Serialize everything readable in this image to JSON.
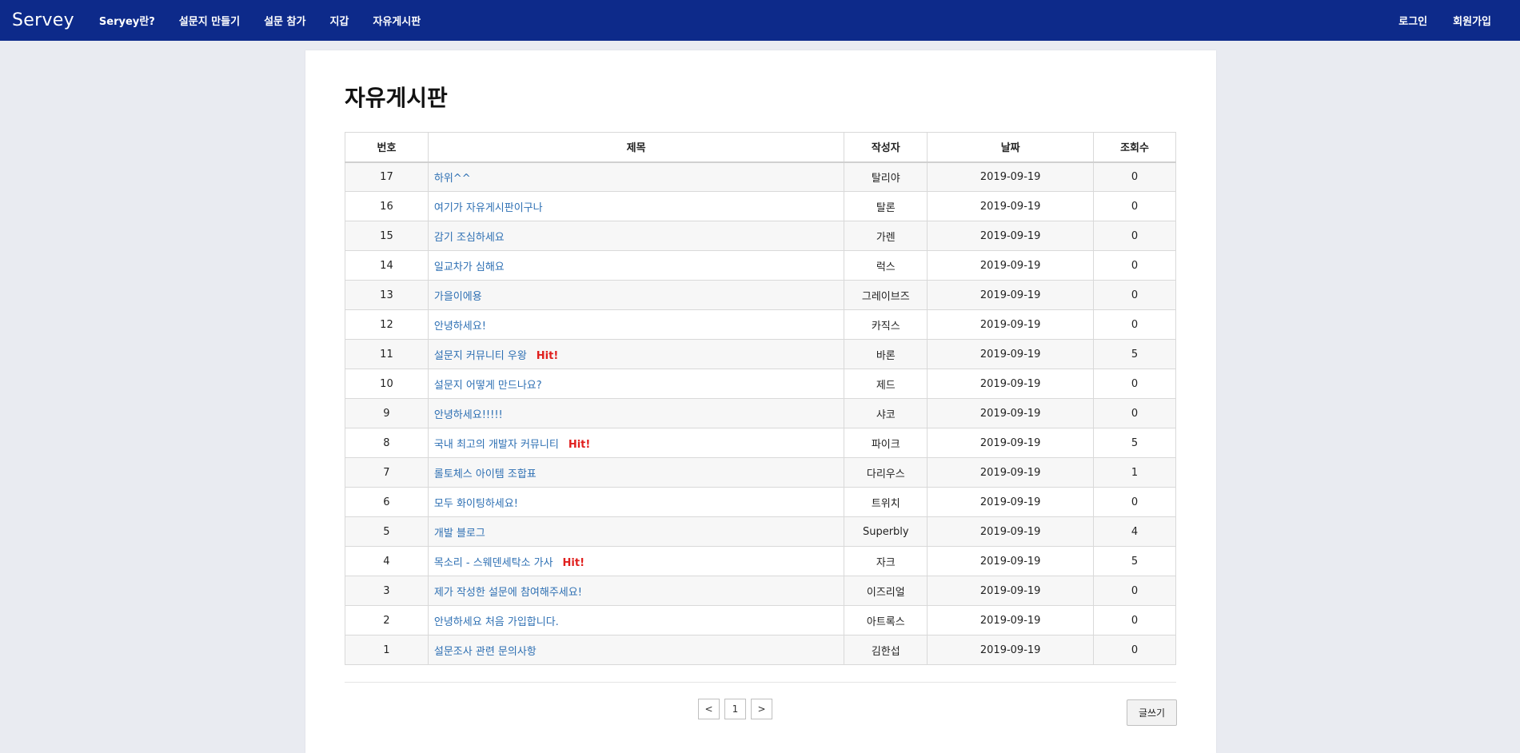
{
  "nav": {
    "brand": "Servey",
    "links": [
      "Seryey란?",
      "설문지 만들기",
      "설문 참가",
      "지갑",
      "자유게시판"
    ],
    "login": "로그인",
    "signup": "회원가입"
  },
  "page": {
    "title": "자유게시판"
  },
  "table": {
    "headers": [
      "번호",
      "제목",
      "작성자",
      "날짜",
      "조회수"
    ],
    "rows": [
      {
        "no": "17",
        "title": "하위^^",
        "hit": "",
        "author": "탈리야",
        "date": "2019-09-19",
        "views": "0"
      },
      {
        "no": "16",
        "title": "여기가 자유게시판이구나",
        "hit": "",
        "author": "탈론",
        "date": "2019-09-19",
        "views": "0"
      },
      {
        "no": "15",
        "title": "감기 조심하세요",
        "hit": "",
        "author": "가렌",
        "date": "2019-09-19",
        "views": "0"
      },
      {
        "no": "14",
        "title": "일교차가 심해요",
        "hit": "",
        "author": "럭스",
        "date": "2019-09-19",
        "views": "0"
      },
      {
        "no": "13",
        "title": "가을이에용",
        "hit": "",
        "author": "그레이브즈",
        "date": "2019-09-19",
        "views": "0"
      },
      {
        "no": "12",
        "title": "안녕하세요!",
        "hit": "",
        "author": "카직스",
        "date": "2019-09-19",
        "views": "0"
      },
      {
        "no": "11",
        "title": "설문지 커뮤니티 우왕",
        "hit": "Hit!",
        "author": "바론",
        "date": "2019-09-19",
        "views": "5"
      },
      {
        "no": "10",
        "title": "설문지 어떻게 만드나요?",
        "hit": "",
        "author": "제드",
        "date": "2019-09-19",
        "views": "0"
      },
      {
        "no": "9",
        "title": "안녕하세요!!!!!",
        "hit": "",
        "author": "샤코",
        "date": "2019-09-19",
        "views": "0"
      },
      {
        "no": "8",
        "title": "국내 최고의 개발자 커뮤니티",
        "hit": "Hit!",
        "author": "파이크",
        "date": "2019-09-19",
        "views": "5"
      },
      {
        "no": "7",
        "title": "롤토체스 아이템 조합표",
        "hit": "",
        "author": "다리우스",
        "date": "2019-09-19",
        "views": "1"
      },
      {
        "no": "6",
        "title": "모두 화이팅하세요!",
        "hit": "",
        "author": "트위치",
        "date": "2019-09-19",
        "views": "0"
      },
      {
        "no": "5",
        "title": "개발 블로그",
        "hit": "",
        "author": "Superbly",
        "date": "2019-09-19",
        "views": "4"
      },
      {
        "no": "4",
        "title": "목소리 - 스웨덴세탁소 가사",
        "hit": "Hit!",
        "author": "자크",
        "date": "2019-09-19",
        "views": "5"
      },
      {
        "no": "3",
        "title": "제가 작성한 설문에 참여해주세요!",
        "hit": "",
        "author": "이즈리얼",
        "date": "2019-09-19",
        "views": "0"
      },
      {
        "no": "2",
        "title": "안녕하세요 처음 가입합니다.",
        "hit": "",
        "author": "아트록스",
        "date": "2019-09-19",
        "views": "0"
      },
      {
        "no": "1",
        "title": "설문조사 관련 문의사항",
        "hit": "",
        "author": "김한섭",
        "date": "2019-09-19",
        "views": "0"
      }
    ]
  },
  "pagination": {
    "prev": "<",
    "current": "1",
    "next": ">"
  },
  "write_button": "글쓰기"
}
